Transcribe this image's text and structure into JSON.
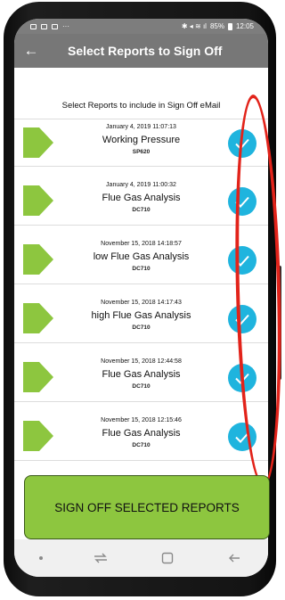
{
  "status_bar": {
    "signal_text": "85%",
    "time": "12:05"
  },
  "app_bar": {
    "back_icon": "arrow-left-icon",
    "title": "Select Reports to Sign Off"
  },
  "instructions": "Select Reports to include in Sign Off eMail",
  "reports": [
    {
      "date": "January 4, 2019 11:07:13",
      "name": "Working Pressure",
      "code": "SP620",
      "checked": true
    },
    {
      "date": "January 4, 2019 11:00:32",
      "name": "Flue Gas Analysis",
      "code": "DC710",
      "checked": true
    },
    {
      "date": "November 15, 2018 14:18:57",
      "name": "low Flue Gas Analysis",
      "code": "DC710",
      "checked": true
    },
    {
      "date": "November 15, 2018 14:17:43",
      "name": "high Flue Gas Analysis",
      "code": "DC710",
      "checked": true
    },
    {
      "date": "November 15, 2018 12:44:58",
      "name": "Flue Gas Analysis",
      "code": "DC710",
      "checked": true
    },
    {
      "date": "November 15, 2018 12:15:46",
      "name": "Flue Gas Analysis",
      "code": "DC710",
      "checked": true
    }
  ],
  "sign_off_button": "SIGN OFF SELECTED REPORTS",
  "colors": {
    "app_bar": "#777777",
    "check": "#1fb4de",
    "tag": "#8dc63f",
    "button": "#8dc63f",
    "annotation": "#e2231a"
  },
  "nav_bar": {
    "icons": [
      "dot-icon",
      "recent-apps-icon",
      "home-square-icon",
      "back-arrow-icon"
    ]
  }
}
